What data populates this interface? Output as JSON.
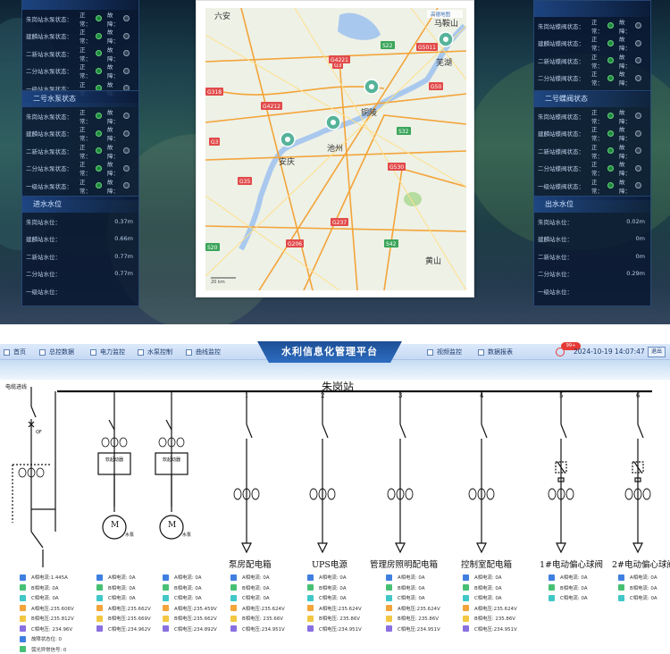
{
  "top": {
    "left_panels": [
      {
        "title": "",
        "rows": [
          {
            "name": "朱岗站水泵状态：",
            "normal": "正常：",
            "fault": "故障："
          },
          {
            "name": "建麟站水泵状态：",
            "normal": "正常：",
            "fault": "故障："
          },
          {
            "name": "二新站水泵状态：",
            "normal": "正常：",
            "fault": "故障："
          },
          {
            "name": "二分站水泵状态：",
            "normal": "正常：",
            "fault": "故障："
          },
          {
            "name": "一级站水泵状态：",
            "normal": "正常：",
            "fault": "故障："
          }
        ]
      },
      {
        "title": "二号水泵状态",
        "rows": [
          {
            "name": "朱岗站水泵状态：",
            "normal": "正常：",
            "fault": "故障："
          },
          {
            "name": "建麟站水泵状态：",
            "normal": "正常：",
            "fault": "故障："
          },
          {
            "name": "二新站水泵状态：",
            "normal": "正常：",
            "fault": "故障："
          },
          {
            "name": "二分站水泵状态：",
            "normal": "正常：",
            "fault": "故障："
          },
          {
            "name": "一级站水泵状态：",
            "normal": "正常：",
            "fault": "故障："
          }
        ]
      },
      {
        "title": "进水水位",
        "rows": [
          {
            "name": "朱岗站水位：",
            "value": "0.37m"
          },
          {
            "name": "建麟站水位：",
            "value": "0.66m"
          },
          {
            "name": "二新站水位：",
            "value": "0.77m"
          },
          {
            "name": "二分站水位：",
            "value": "0.77m"
          },
          {
            "name": "一级站水位：",
            "value": ""
          }
        ]
      }
    ],
    "right_panels": [
      {
        "title": "",
        "rows": [
          {
            "name": "朱岗站蝶阀状态：",
            "normal": "正常：",
            "fault": "故障："
          },
          {
            "name": "建麟站蝶阀状态：",
            "normal": "正常：",
            "fault": "故障："
          },
          {
            "name": "二新站蝶阀状态：",
            "normal": "正常：",
            "fault": "故障："
          },
          {
            "name": "二分站蝶阀状态：",
            "normal": "正常：",
            "fault": "故障："
          }
        ]
      },
      {
        "title": "二号蝶阀状态",
        "rows": [
          {
            "name": "朱岗站蝶阀状态：",
            "normal": "正常：",
            "fault": "故障："
          },
          {
            "name": "建麟站蝶阀状态：",
            "normal": "正常：",
            "fault": "故障："
          },
          {
            "name": "二新站蝶阀状态：",
            "normal": "正常：",
            "fault": "故障："
          },
          {
            "name": "二分站蝶阀状态：",
            "normal": "正常：",
            "fault": "故障："
          },
          {
            "name": "一级站蝶阀状态：",
            "normal": "正常：",
            "fault": "故障："
          }
        ]
      },
      {
        "title": "出水水位",
        "rows": [
          {
            "name": "朱岗站水位：",
            "value": "0.02m"
          },
          {
            "name": "建麟站水位：",
            "value": "0m"
          },
          {
            "name": "二新站水位：",
            "value": "0m"
          },
          {
            "name": "二分站水位：",
            "value": "0.29m"
          },
          {
            "name": "一级站水位：",
            "value": ""
          }
        ]
      }
    ],
    "map": {
      "attribution": "高德地图",
      "scale": "20 km",
      "cities": [
        {
          "name": "六安",
          "big": true
        },
        {
          "name": "马鞍山",
          "big": true
        },
        {
          "name": "芜湖",
          "big": true
        },
        {
          "name": "铜陵",
          "big": true
        },
        {
          "name": "池州",
          "big": true
        },
        {
          "name": "安庆",
          "big": true
        },
        {
          "name": "黄山",
          "big": true
        }
      ],
      "roads": [
        "G3",
        "S22",
        "G5011",
        "G4221",
        "G50",
        "G4212",
        "G318",
        "S32",
        "G35",
        "S20",
        "G3",
        "G530",
        "G206",
        "S42",
        "G237"
      ]
    }
  },
  "nav": {
    "items": [
      "首页",
      "总控数据",
      "电力监控",
      "水泵控制",
      "曲线监控"
    ],
    "right_items": [
      "视频监控",
      "数据报表"
    ],
    "title": "水利信息化管理平台",
    "datetime": "2024-10-19 14:07:47",
    "badge": "99+",
    "exit": "退出"
  },
  "diagram": {
    "station": "朱岗站",
    "incoming": "电缆进线",
    "qf": "QF",
    "soft_starter": "软起动器",
    "motor": "M",
    "pump": "水泵",
    "bus_numbers": [
      "1",
      "2",
      "3",
      "4",
      "5",
      "6"
    ],
    "feeders": [
      "泵房配电箱",
      "UPS电源",
      "管理房照明配电箱",
      "控制室配电箱",
      "1#电动偏心球阀",
      "2#电动偏心球阀"
    ],
    "readings": [
      [
        "A相电流:1.445A",
        "B相电流: 0A",
        "C相电流: 0A",
        "A相电压:235.606V",
        "B相电压:235.812V",
        "C相电压: 234.96V",
        "故障状态位: 0",
        "弧光异常信号: 0"
      ],
      [
        "A相电流: 0A",
        "B相电流: 0A",
        "C相电流: 0A",
        "A相电压:235.662V",
        "B相电压:235.669V",
        "C相电压:234.962V"
      ],
      [
        "A相电流: 0A",
        "B相电流: 0A",
        "C相电流: 0A",
        "A相电压:235.459V",
        "B相电压:235.662V",
        "C相电压:234.892V"
      ],
      [
        "A相电流: 0A",
        "B相电流: 0A",
        "C相电流: 0A",
        "A相电压:235.624V",
        "B相电压: 235.66V",
        "C相电压:234.951V"
      ],
      [
        "A相电流: 0A",
        "B相电流: 0A",
        "C相电流: 0A",
        "A相电压:235.624V",
        "B相电压: 235.86V",
        "C相电压:234.951V"
      ],
      [
        "A相电流: 0A",
        "B相电流: 0A",
        "C相电流: 0A",
        "A相电压:235.624V",
        "B相电压: 235.86V",
        "C相电压:234.951V"
      ],
      [
        "A相电流: 0A",
        "B相电流: 0A",
        "C相电流: 0A",
        "A相电压:235.624V",
        "B相电压: 235.86V",
        "C相电压:234.951V"
      ],
      [
        "A相电流: 0A",
        "B相电流: 0A",
        "C相电流: 0A"
      ],
      [
        "A相电流: 0A",
        "B相电流: 0A",
        "C相电流: 0A"
      ]
    ]
  }
}
